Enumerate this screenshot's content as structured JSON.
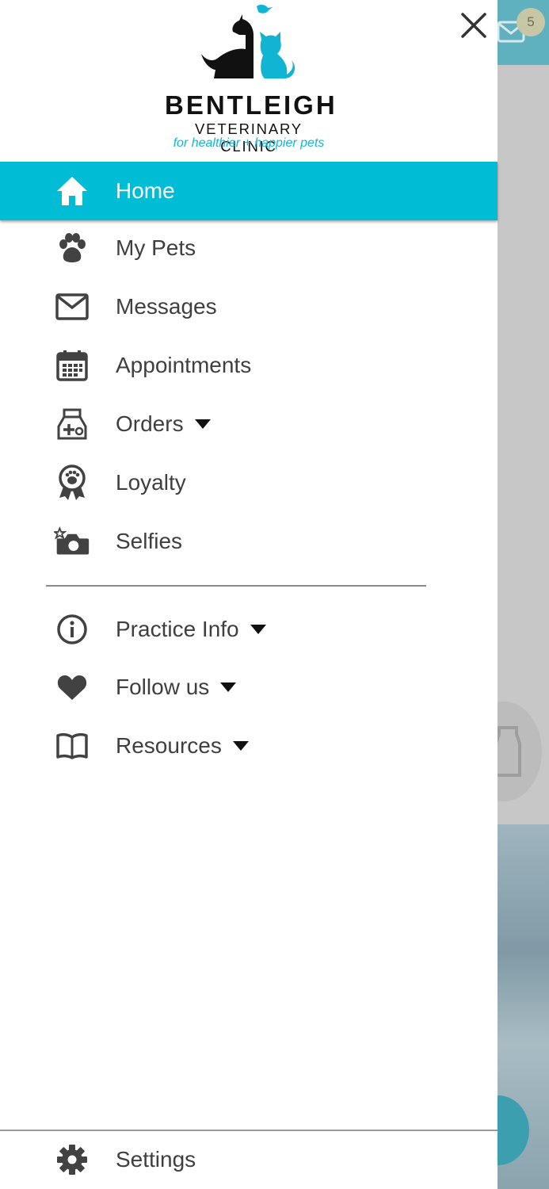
{
  "background": {
    "mail_badge_count": "5",
    "colors": {
      "topbar": "#5fb1c0",
      "overlay": "#c7c7c7",
      "fab": "#3c9fb0"
    }
  },
  "drawer": {
    "close_icon": "close-icon",
    "logo": {
      "line1": "BENTLEIGH",
      "line2": "VETERINARY CLINIC",
      "tagline": "for healthier + happier pets"
    },
    "accent_color": "#00bcd4",
    "items": [
      {
        "label": "Home",
        "icon": "home-icon",
        "active": true
      },
      {
        "label": "My Pets",
        "icon": "paw-icon"
      },
      {
        "label": "Messages",
        "icon": "envelope-icon"
      },
      {
        "label": "Appointments",
        "icon": "calendar-icon"
      },
      {
        "label": "Orders",
        "icon": "pet-food-bag-icon",
        "expandable": true
      },
      {
        "label": "Loyalty",
        "icon": "award-ribbon-icon"
      },
      {
        "label": "Selfies",
        "icon": "camera-star-icon"
      }
    ],
    "secondary_items": [
      {
        "label": "Practice Info",
        "icon": "info-icon",
        "expandable": true
      },
      {
        "label": "Follow us",
        "icon": "heart-icon",
        "expandable": true
      },
      {
        "label": "Resources",
        "icon": "book-icon",
        "expandable": true
      }
    ],
    "footer": {
      "label": "Settings",
      "icon": "gear-icon"
    }
  }
}
